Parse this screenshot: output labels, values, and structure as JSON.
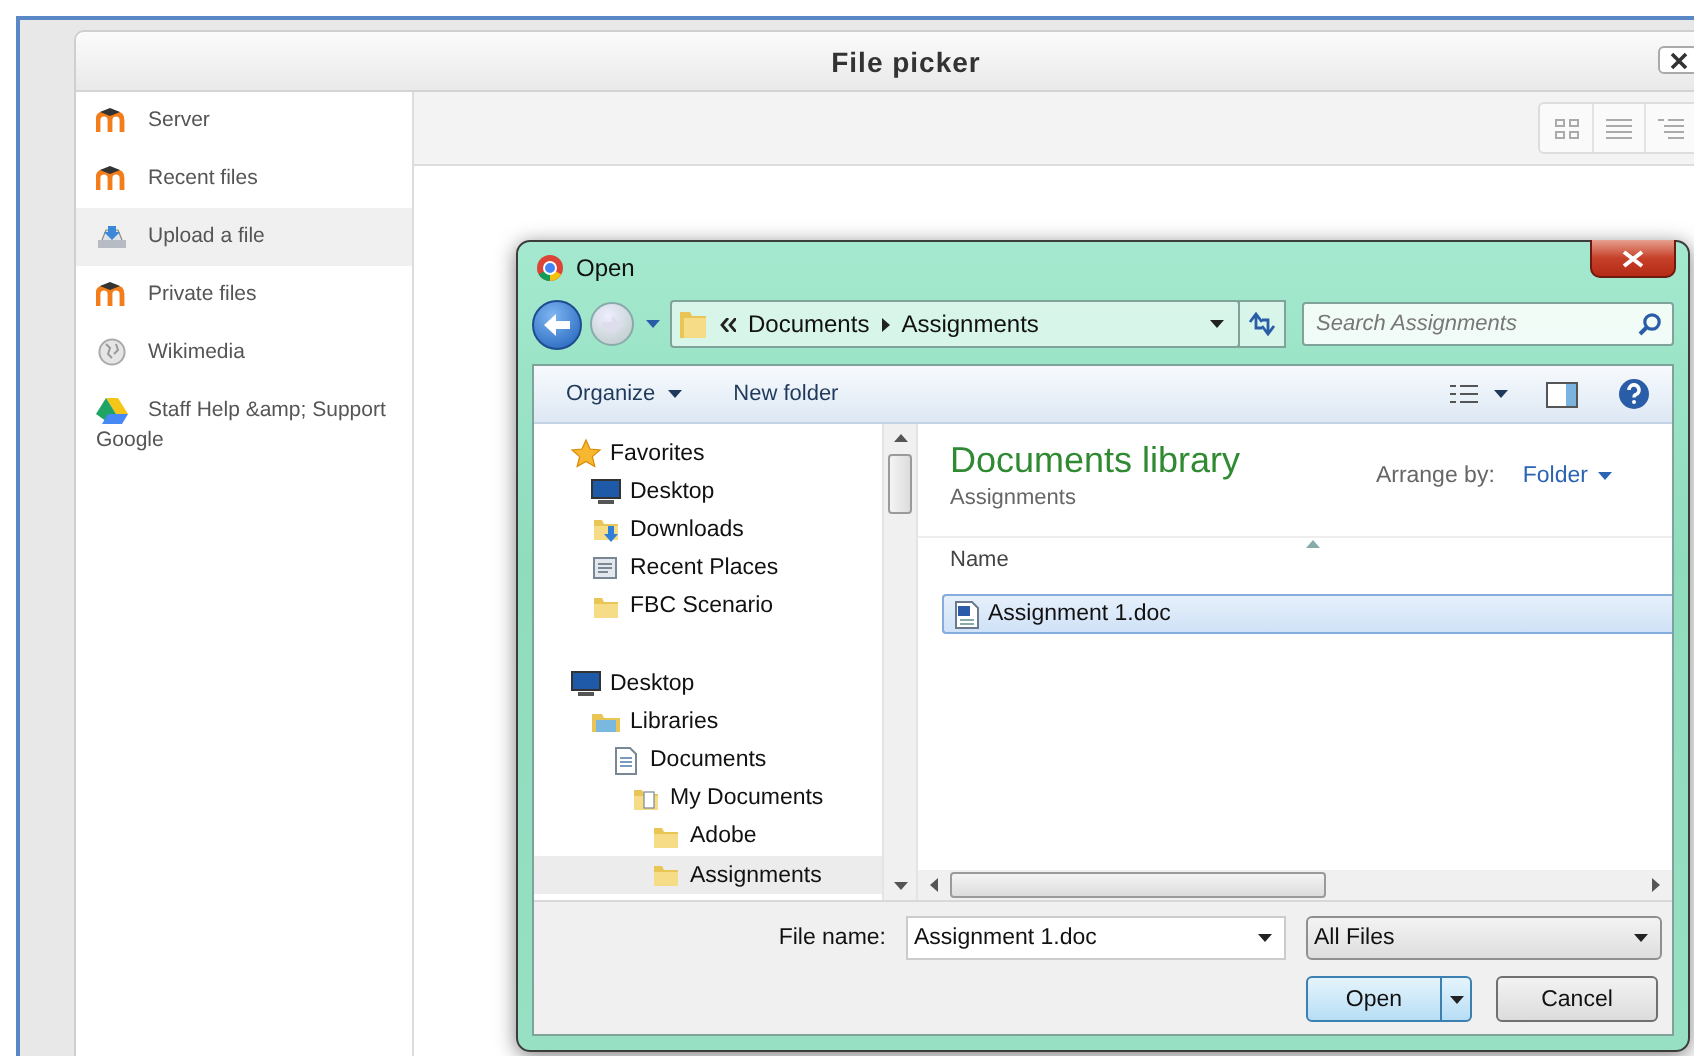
{
  "file_picker": {
    "title": "File picker",
    "repositories": [
      {
        "label": "Server",
        "kind": "moodle",
        "selected": false
      },
      {
        "label": "Recent files",
        "kind": "moodle",
        "selected": false
      },
      {
        "label": "Upload a file",
        "kind": "upload",
        "selected": true
      },
      {
        "label": "Private files",
        "kind": "moodle",
        "selected": false
      },
      {
        "label": "Wikimedia",
        "kind": "wiki",
        "selected": false
      },
      {
        "label": "Staff Help &amp; Support Google",
        "kind": "drive",
        "selected": false
      }
    ]
  },
  "open_dialog": {
    "title": "Open",
    "address": {
      "crumbs": [
        "Documents",
        "Assignments"
      ]
    },
    "search": {
      "placeholder": "Search Assignments"
    },
    "toolbar": {
      "organize": "Organize",
      "new_folder": "New folder"
    },
    "nav": [
      {
        "label": "Favorites",
        "kind": "star",
        "selected": false,
        "children": [
          {
            "label": "Desktop",
            "kind": "desktop",
            "selected": false
          },
          {
            "label": "Downloads",
            "kind": "downloads",
            "selected": false
          },
          {
            "label": "Recent Places",
            "kind": "recent",
            "selected": false
          },
          {
            "label": "FBC Scenario",
            "kind": "folder",
            "selected": false
          }
        ]
      },
      {
        "label": "Desktop",
        "kind": "desktop",
        "selected": false,
        "children": [
          {
            "label": "Libraries",
            "kind": "library",
            "selected": false,
            "children": [
              {
                "label": "Documents",
                "kind": "document",
                "selected": false,
                "children": [
                  {
                    "label": "My Documents",
                    "kind": "docfolder",
                    "selected": false,
                    "children": [
                      {
                        "label": "Adobe",
                        "kind": "folder",
                        "selected": false
                      },
                      {
                        "label": "Assignments",
                        "kind": "folder",
                        "selected": true
                      }
                    ]
                  }
                ]
              }
            ]
          }
        ]
      }
    ],
    "library": {
      "title": "Documents library",
      "subtitle": "Assignments",
      "arrange_label": "Arrange by:",
      "arrange_value": "Folder"
    },
    "columns": [
      "Name"
    ],
    "files": [
      {
        "name": "Assignment 1.doc",
        "selected": true
      }
    ],
    "file_name_label": "File name:",
    "file_name": "Assignment 1.doc",
    "filter": "All Files",
    "buttons": {
      "open": "Open",
      "cancel": "Cancel"
    }
  }
}
